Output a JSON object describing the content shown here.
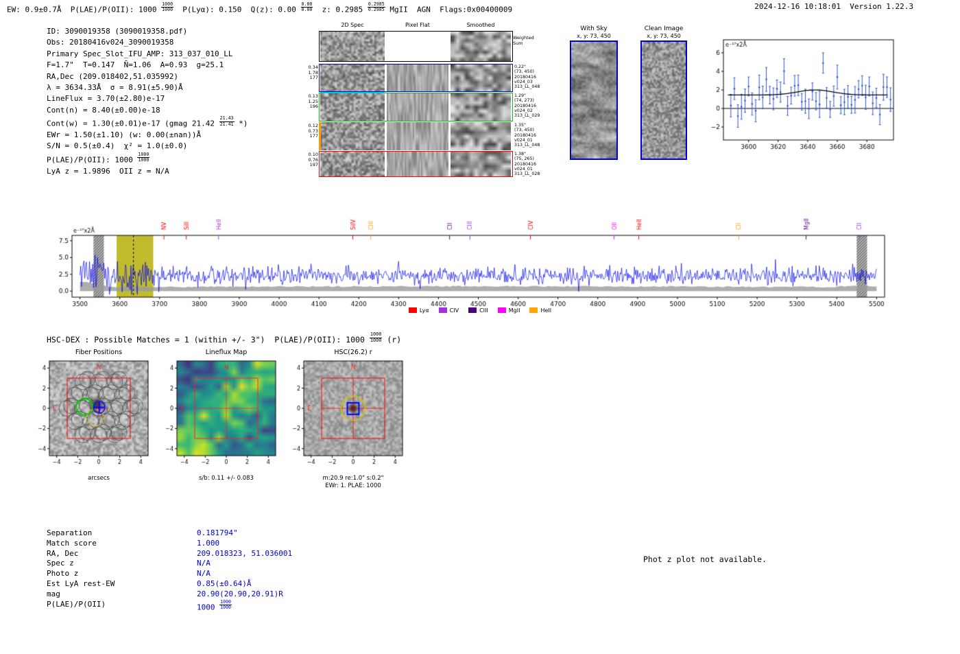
{
  "header": {
    "left_segments": [
      {
        "t": "EW: 0.9±0.7Å  P(LAE)/P(OII): 1000 "
      },
      {
        "f": [
          "1000",
          "1000"
        ]
      },
      {
        "t": "  P(Lyα): 0.150  Q(z): 0.00 "
      },
      {
        "f": [
          "0.00",
          "0.00"
        ]
      },
      {
        "t": "  z: 0.2985 "
      },
      {
        "f": [
          "0.2985",
          "0.2985"
        ]
      },
      {
        "t": " MgII  AGN  Flags:0x00400009"
      }
    ],
    "right": "2024-12-16 10:18:01  Version 1.22.3"
  },
  "info_block": {
    "lines": [
      [
        {
          "t": "ID: 3090019358 (3090019358.pdf)"
        }
      ],
      [
        {
          "t": "Obs: 20180416v024_3090019358"
        }
      ],
      [
        {
          "t": "Primary Spec_Slot_IFU_AMP: 313_037_010_LL"
        }
      ],
      [
        {
          "t": "F=1.7\"  T=0.147  N̄=1.06  A=0.93  g=25.1"
        }
      ],
      [
        {
          "t": "RA,Dec (209.018402,51.035992)"
        }
      ],
      [
        {
          "t": "λ = 3634.33Å  σ = 8.91(±5.90)Å"
        }
      ],
      [
        {
          "t": "LineFlux = 3.70(±2.80)e-17"
        }
      ],
      [
        {
          "t": "Cont(n) = 8.40(±0.00)e-18"
        }
      ],
      [
        {
          "t": "Cont(w) = 1.30(±0.01)e-17 (gmag 21.42 "
        },
        {
          "f": [
            "21.43",
            "21.41"
          ]
        },
        {
          "t": " *)"
        }
      ],
      [
        {
          "t": "EWr = 1.50(±1.10) (w: 0.00(±nan))Å"
        }
      ],
      [
        {
          "t": "S/N = 0.5(±0.4)  χ² = 1.0(±0.0)"
        }
      ],
      [
        {
          "t": "P(LAE)/P(OII): 1000 "
        },
        {
          "f": [
            "1000",
            "1000"
          ]
        }
      ],
      [
        {
          "t": "LyA z = 1.9896  OII z = N/A"
        }
      ]
    ]
  },
  "spec2d": {
    "col_headers": [
      "2D Spec",
      "Pixel Flat",
      "Smoothed"
    ],
    "weighted_label": [
      "Weighted",
      "Sum"
    ],
    "rows": [
      {
        "left": [],
        "right": [],
        "border": "#000000",
        "style": "box"
      },
      {
        "left": [
          "0.34",
          "1.78",
          "177"
        ],
        "right": [
          "0.22\"",
          "(73, 450)",
          "20180416",
          "v024_03",
          "313_LL_048"
        ],
        "border": "#0000ff",
        "style": "box"
      },
      {
        "left": [
          "0.13",
          "1.25",
          "196"
        ],
        "right": [
          "1.29\"",
          "(74, 273)",
          "20180416",
          "v024_02",
          "313_LL_029"
        ],
        "border": "#00c800",
        "style": "box"
      },
      {
        "left": [
          "0.12",
          "0.73",
          "177"
        ],
        "right": [
          "1.35\"",
          "(73, 450)",
          "20180416",
          "v024_01",
          "313_LL_048"
        ],
        "border": "#ff9900",
        "style": "left"
      },
      {
        "left": [
          "0.10",
          "0.76",
          "197"
        ],
        "right": [
          "1.38\"",
          "(75, 265)",
          "20180416",
          "v024_01",
          "313_LL_028"
        ],
        "border": "#ff0000",
        "style": "box"
      }
    ]
  },
  "sky_panel": {
    "title": "With Sky",
    "subtitle": "x, y: 73, 450"
  },
  "clean_panel": {
    "title": "Clean Image",
    "subtitle": "x, y: 73, 450"
  },
  "hsc_line_segments": [
    {
      "t": "HSC-DEX : Possible Matches = 1 (within +/- 3\")  P(LAE)/P(OII): 1000 "
    },
    {
      "f": [
        "1000",
        "1000"
      ]
    },
    {
      "t": " (r)"
    }
  ],
  "cutouts": {
    "arcsec_range": [
      -4.7,
      4.7
    ],
    "ticks": [
      -4,
      -2,
      0,
      2,
      4
    ],
    "compass": {
      "north": "N",
      "east": "E",
      "color": "#ee2222"
    },
    "panels": [
      {
        "title": "Fiber Positions",
        "xlabel": "arcsecs",
        "xlabel2": "",
        "type": "fibers"
      },
      {
        "title": "Lineflux Map",
        "xlabel": "s/b: 0.11 +/- 0.083",
        "xlabel2": "",
        "type": "lineflux"
      },
      {
        "title": "HSC(26.2) r",
        "xlabel": "m:20.9 re:1.0\" s:0.2\"",
        "xlabel2": "EWr: 1. PLAE: 1000",
        "type": "hsc"
      }
    ]
  },
  "match_table": {
    "value_color": "#0000cd",
    "rows": [
      {
        "label": "Separation",
        "segments": [
          {
            "t": "0.181794\""
          }
        ]
      },
      {
        "label": "Match score",
        "segments": [
          {
            "t": "1.000"
          }
        ]
      },
      {
        "label": "RA, Dec",
        "segments": [
          {
            "t": "209.018323, 51.036001"
          }
        ]
      },
      {
        "label": "Spec z",
        "segments": [
          {
            "t": "N/A"
          }
        ]
      },
      {
        "label": "Photo z",
        "segments": [
          {
            "t": "N/A"
          }
        ]
      },
      {
        "label": "Est LyA rest-EW",
        "segments": [
          {
            "t": "0.85(±0.64)Å"
          }
        ]
      },
      {
        "label": "mag",
        "segments": [
          {
            "t": "20.90(20.90,20.91)R"
          }
        ]
      },
      {
        "label": "P(LAE)/P(OII)",
        "segments": [
          {
            "t": "1000 "
          },
          {
            "f": [
              "1000",
              "1000"
            ]
          }
        ]
      }
    ]
  },
  "photz_note": "Phot z plot not available.",
  "chart_data": [
    {
      "id": "emission_line_fit_inset",
      "type": "scatter",
      "annotation": "e⁻¹⁷x2Å",
      "xlim": [
        3583,
        3698
      ],
      "ylim": [
        -3.4,
        7.4
      ],
      "xticks": [
        3600,
        3620,
        3640,
        3660,
        3680
      ],
      "yticks": [
        -2,
        0,
        2,
        4,
        6
      ],
      "point_color": "#3355cc",
      "fit_color": "#000000",
      "zero_line_y": 0,
      "points_approx": {
        "n": 46,
        "x_start": 3588,
        "x_step": 2.4,
        "baseline": 1.5,
        "scatter_sigma": 1.05,
        "errorbar": 1.15,
        "seed": 11
      },
      "fit_curve": {
        "baseline": 1.45,
        "bump_center": 3645,
        "bump_sigma": 12,
        "bump_height": 0.55
      }
    },
    {
      "id": "full_spectrum",
      "type": "line",
      "annotation": "e⁻¹⁷x2Å",
      "xlim": [
        3480,
        5520
      ],
      "ylim": [
        -0.9,
        8.3
      ],
      "xticks": [
        3500,
        3600,
        3700,
        3800,
        3900,
        4000,
        4100,
        4200,
        4300,
        4400,
        4500,
        4600,
        4700,
        4800,
        4900,
        5000,
        5100,
        5200,
        5300,
        5400,
        5500
      ],
      "yticks": [
        0.0,
        2.5,
        5.0,
        7.5
      ],
      "line_color": "#0000ee",
      "noise_model": {
        "seed": 5,
        "baseline": 2.3,
        "sigma_default": 0.62,
        "sigma_left_edge": 1.9,
        "sigma_detect_region": 1.25,
        "step": 2
      },
      "error_band": {
        "color": "#9a9a9a",
        "height": 0.8
      },
      "detect_band": {
        "x0": 3592,
        "x1": 3684,
        "color": "#b9b516"
      },
      "detect_line_x": 3634.33,
      "masked_bands": [
        [
          3534,
          3560
        ],
        [
          5450,
          5476
        ]
      ],
      "line_markers": [
        {
          "label": "NV",
          "wavelength": 3711,
          "color": "#ff0000"
        },
        {
          "label": "SiII",
          "wavelength": 3767,
          "color": "#ff0000"
        },
        {
          "label": "HeII",
          "wavelength": 3848,
          "color": "#a033dd"
        },
        {
          "label": "SiIV",
          "wavelength": 4185,
          "color": "#ff0000"
        },
        {
          "label": "CIII",
          "wavelength": 4230,
          "color": "#ffa500"
        },
        {
          "label": "CII",
          "wavelength": 4428,
          "color": "#4b0082"
        },
        {
          "label": "CIII",
          "wavelength": 4479,
          "color": "#a033dd"
        },
        {
          "label": "CIV",
          "wavelength": 4631,
          "color": "#ff0000"
        },
        {
          "label": "OII",
          "wavelength": 4841,
          "color": "#ff00ff"
        },
        {
          "label": "HeII",
          "wavelength": 4903,
          "color": "#ff0000"
        },
        {
          "label": "CII",
          "wavelength": 5154,
          "color": "#ffa500"
        },
        {
          "label": "MgII",
          "wavelength": 5323,
          "color": "#4b0082"
        },
        {
          "label": "CII",
          "wavelength": 5457,
          "color": "#a033dd"
        }
      ],
      "legend": [
        {
          "label": "Lyα",
          "color": "#ff0000"
        },
        {
          "label": "CIV",
          "color": "#a033dd"
        },
        {
          "label": "CIII",
          "color": "#4b0082"
        },
        {
          "label": "MgII",
          "color": "#ff00ff"
        },
        {
          "label": "HeII",
          "color": "#ffa500"
        }
      ],
      "legend_position": "bottom-center"
    }
  ]
}
